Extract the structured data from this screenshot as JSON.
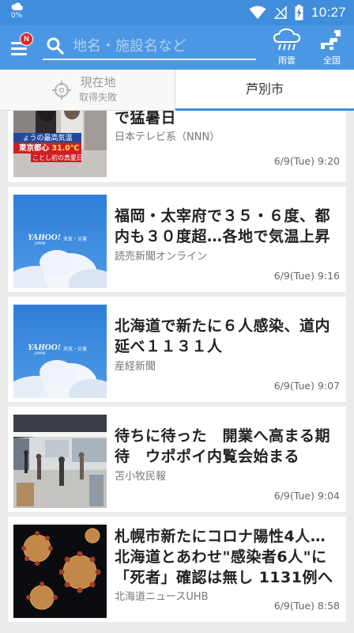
{
  "status_bar": {
    "battery_pct": "0%",
    "time": "10:27",
    "icons": [
      "weather-cloud-icon",
      "wifi-icon",
      "no-signal-icon",
      "battery-charging-icon"
    ]
  },
  "app_bar": {
    "badge": "N",
    "search_placeholder": "地名・施設名など",
    "rain_label": "雨雲",
    "nation_label": "全国"
  },
  "tabs": {
    "current_title": "現在地",
    "current_sub": "取得失敗",
    "city": "芦別市"
  },
  "news": [
    {
      "headline_lines": [
        "で猛暑日"
      ],
      "source": "日本テレビ系（NNN）",
      "date": "6/9(Tue) 9:20",
      "thumb_caption": "ょうの最高気温",
      "thumb_city": "東京都心",
      "thumb_temp": "31.0℃",
      "thumb_sub": "ことし初の真夏日"
    },
    {
      "headline_lines": [
        "福岡・太宰府で３５・６度、都",
        "内も３０度超…各地で気温上昇"
      ],
      "source": "読売新聞オンライン",
      "date": "6/9(Tue) 9:16",
      "thumb_logo": "YAHOO!",
      "thumb_logo_sub": "JAPAN",
      "thumb_tag": "天気・災害"
    },
    {
      "headline_lines": [
        "北海道で新たに６人感染、道内",
        "延べ１１３１人"
      ],
      "source": "産経新聞",
      "date": "6/9(Tue) 9:07",
      "thumb_logo": "YAHOO!",
      "thumb_logo_sub": "JAPAN",
      "thumb_tag": "天気・災害"
    },
    {
      "headline_lines": [
        "待ちに待った　開業へ高まる期",
        "待　ウポポイ内覧会始まる"
      ],
      "source": "苫小牧民報",
      "date": "6/9(Tue) 9:04"
    },
    {
      "headline_lines": [
        "札幌市新たにコロナ陽性4人…",
        "北海道とあわせ\"感染者6人\"に",
        "「死者」確認は無し 1131例へ"
      ],
      "source": "北海道ニュースUHB",
      "date": "6/9(Tue) 8:58"
    }
  ]
}
